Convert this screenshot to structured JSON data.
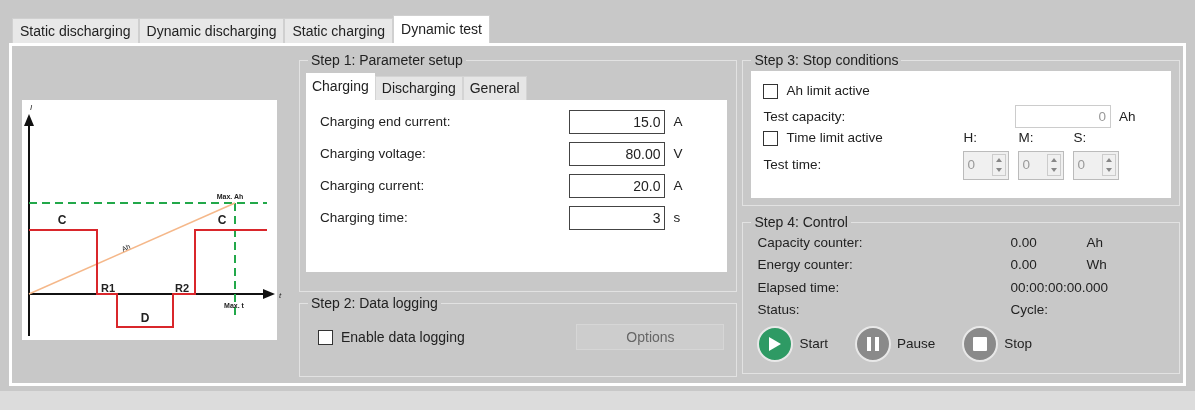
{
  "tabs": [
    {
      "label": "Static discharging",
      "selected": false
    },
    {
      "label": "Dynamic discharging",
      "selected": false
    },
    {
      "label": "Static charging",
      "selected": false
    },
    {
      "label": "Dynamic test",
      "selected": true
    }
  ],
  "diagram": {
    "labels": [
      {
        "kind": "y_axis",
        "text": "I"
      },
      {
        "kind": "x_axis",
        "text": "t"
      },
      {
        "kind": "c1",
        "text": "C"
      },
      {
        "kind": "ah",
        "text": "Ah"
      },
      {
        "kind": "r1",
        "text": "R1"
      },
      {
        "kind": "r2",
        "text": "R2"
      },
      {
        "kind": "d",
        "text": "D"
      },
      {
        "kind": "c2",
        "text": "C"
      },
      {
        "kind": "max_ah",
        "text": "Max. Ah"
      },
      {
        "kind": "max_t",
        "text": "Max. t"
      }
    ]
  },
  "step1": {
    "title": "Step 1: Parameter setup",
    "tabs": [
      {
        "label": "Charging",
        "selected": true
      },
      {
        "label": "Discharging",
        "selected": false
      },
      {
        "label": "General",
        "selected": false
      }
    ],
    "fields": [
      {
        "label": "Charging end current:",
        "value": "15.0",
        "unit": "A"
      },
      {
        "label": "Charging voltage:",
        "value": "80.00",
        "unit": "V"
      },
      {
        "label": "Charging current:",
        "value": "20.0",
        "unit": "A"
      },
      {
        "label": "Charging time:",
        "value": "3",
        "unit": "s"
      }
    ]
  },
  "step2": {
    "title": "Step 2: Data logging",
    "checkbox": {
      "label": "Enable data logging",
      "checked": false
    },
    "options_button": {
      "label": "Options",
      "disabled": true
    }
  },
  "step3": {
    "title": "Step 3: Stop conditions",
    "ah_limit": {
      "label": "Ah limit active",
      "checked": false
    },
    "capacity": {
      "label": "Test capacity:",
      "value": "0",
      "unit": "Ah",
      "disabled": true
    },
    "time_limit": {
      "label": "Time limit active",
      "checked": false
    },
    "time_headers": [
      "H:",
      "M:",
      "S:"
    ],
    "test_time": {
      "label": "Test time:",
      "spinners": [
        {
          "value": "0",
          "disabled": true
        },
        {
          "value": "0",
          "disabled": true
        },
        {
          "value": "0",
          "disabled": true
        }
      ]
    }
  },
  "step4": {
    "title": "Step 4: Control",
    "rows": [
      {
        "label": "Capacity counter:",
        "value": "0.00",
        "unit": "Ah"
      },
      {
        "label": "Energy counter:",
        "value": "0.00",
        "unit": "Wh"
      },
      {
        "label": "Elapsed time:",
        "value": "00:00:00:00.000"
      },
      {
        "label": "Status:",
        "value": "Cycle:"
      }
    ],
    "buttons": [
      {
        "kind": "start",
        "label": "Start",
        "disabled": false
      },
      {
        "kind": "pause",
        "label": "Pause",
        "disabled": true
      },
      {
        "kind": "stop",
        "label": "Stop",
        "disabled": true
      }
    ]
  }
}
